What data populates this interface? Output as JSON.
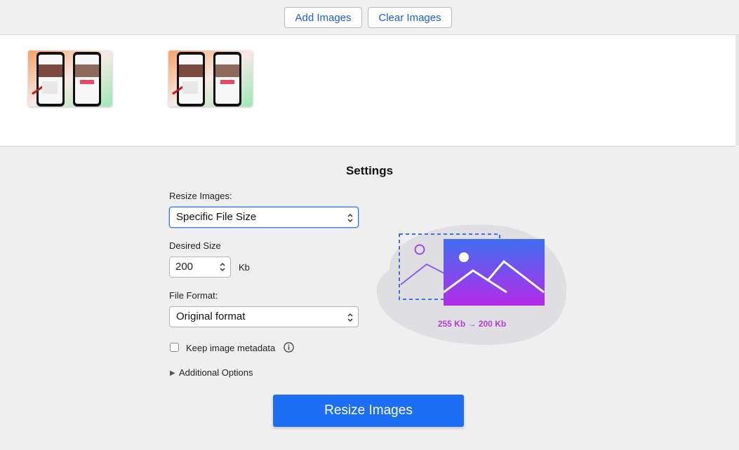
{
  "toolbar": {
    "add_images_label": "Add Images",
    "clear_images_label": "Clear Images"
  },
  "settings": {
    "title": "Settings",
    "resize_images": {
      "label": "Resize Images:",
      "selected": "Specific File Size"
    },
    "desired_size": {
      "label": "Desired Size",
      "value": "200",
      "unit": "Kb"
    },
    "file_format": {
      "label": "File Format:",
      "selected": "Original format"
    },
    "keep_metadata": {
      "label": "Keep image metadata",
      "checked": false
    },
    "additional_options": {
      "label": "Additional Options",
      "expanded": false
    },
    "illustration_caption": "255 Kb → 200 Kb",
    "submit_label": "Resize Images"
  },
  "colors": {
    "accent": "#1c6ef2",
    "link": "#1a5fcf",
    "caption": "#b23bdc"
  },
  "icons": {
    "select_chevron": "chevron-updown-icon",
    "info": "info-icon",
    "disclosure": "disclosure-triangle-icon"
  }
}
